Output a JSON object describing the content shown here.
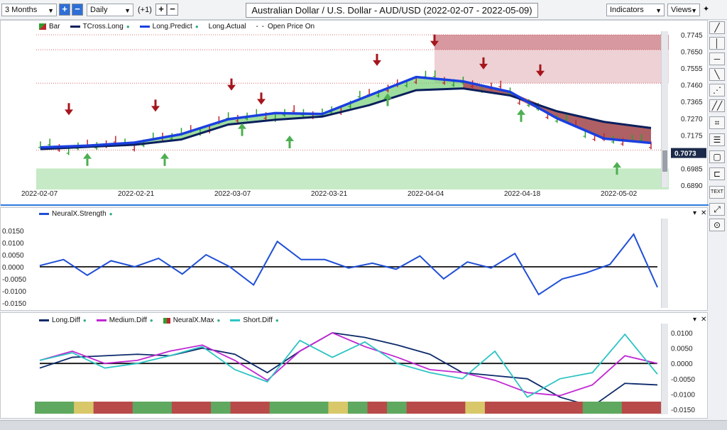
{
  "toolbar": {
    "period": "3 Months",
    "interval": "Daily",
    "offset": "(+1)",
    "indicators": "Indicators",
    "views": "Views",
    "plus": "+",
    "minus": "−",
    "pin": "✦"
  },
  "title": "Australian Dollar / U.S. Dollar - AUD/USD (2022-02-07 - 2022-05-09)",
  "main_legend": {
    "bar": "Bar",
    "tcross": "TCross.Long",
    "predict": "Long.Predict",
    "actual": "Long.Actual",
    "open_on": "Open Price On"
  },
  "price_axis": [
    "0.7745",
    "0.7650",
    "0.7555",
    "0.7460",
    "0.7365",
    "0.7270",
    "0.7175",
    "0.7080",
    "0.6985",
    "0.6890"
  ],
  "current_price": "0.7073",
  "date_axis": [
    "2022-02-07",
    "2022-02-21",
    "2022-03-07",
    "2022-03-21",
    "2022-04-04",
    "2022-04-18",
    "2022-05-02"
  ],
  "neural_legend": "NeuralX.Strength",
  "neural_axis": [
    "0.0150",
    "0.0100",
    "0.0050",
    "0.0000",
    "-0.0050",
    "-0.0100",
    "-0.0150"
  ],
  "diff_legend": {
    "long": "Long.Diff",
    "medium": "Medium.Diff",
    "max": "NeuralX.Max",
    "short": "Short.Diff"
  },
  "diff_axis": [
    "0.0100",
    "0.0050",
    "0.0000",
    "-0.0050",
    "-0.0100",
    "-0.0150"
  ],
  "right_tools": [
    "╱",
    "│",
    "─",
    "╲",
    "⋰",
    "╱╱",
    "⌗",
    "☰",
    "▢",
    "⊏",
    "TEXT",
    "⤢",
    "⊙",
    "✕"
  ],
  "panel_controls": {
    "collapse": "▾",
    "close": "✕"
  },
  "colors": {
    "up_bar": "#2e9e2e",
    "down_bar": "#c0262d",
    "tcross": "#0a1f5c",
    "predict": "#1a3fe0",
    "neural": "#1f4fd6",
    "long_diff": "#0d2a6b",
    "medium_diff": "#c026d3",
    "short_diff": "#2ec4c4",
    "up_zone": "#7ed17e",
    "down_zone": "#b04a5a"
  },
  "chart_data": [
    {
      "type": "line",
      "title": "Australian Dollar / U.S. Dollar - AUD/USD (2022-02-07 - 2022-05-09)",
      "xlabel": "",
      "ylabel": "",
      "ylim": [
        0.689,
        0.7745
      ],
      "x": [
        "2022-02-07",
        "2022-02-14",
        "2022-02-21",
        "2022-02-28",
        "2022-03-07",
        "2022-03-14",
        "2022-03-21",
        "2022-03-28",
        "2022-04-04",
        "2022-04-11",
        "2022-04-18",
        "2022-04-25",
        "2022-05-02",
        "2022-05-09"
      ],
      "series": [
        {
          "name": "TCross.Long",
          "values": [
            0.7095,
            0.7108,
            0.712,
            0.715,
            0.7235,
            0.7262,
            0.728,
            0.7345,
            0.743,
            0.744,
            0.74,
            0.731,
            0.725,
            0.7215
          ]
        },
        {
          "name": "Long.Predict",
          "values": [
            0.7105,
            0.7115,
            0.7132,
            0.718,
            0.7265,
            0.73,
            0.7295,
            0.74,
            0.7505,
            0.748,
            0.742,
            0.727,
            0.7155,
            0.713
          ]
        }
      ],
      "current_price": 0.7073
    },
    {
      "type": "line",
      "title": "",
      "ylim": [
        -0.015,
        0.015
      ],
      "series": [
        {
          "name": "NeuralX.Strength",
          "values": [
            0.0005,
            0.003,
            -0.0035,
            0.0025,
            0.0,
            0.0035,
            -0.003,
            0.005,
            0.0,
            -0.0075,
            0.0105,
            0.003,
            0.003,
            -0.0005,
            0.0015,
            -0.001,
            0.0045,
            -0.005,
            0.002,
            -0.0005,
            0.0055,
            -0.0115,
            -0.005,
            -0.0025,
            0.001,
            0.0135,
            -0.0085
          ]
        }
      ]
    },
    {
      "type": "line",
      "title": "",
      "ylim": [
        -0.015,
        0.01
      ],
      "series": [
        {
          "name": "Long.Diff",
          "values": [
            -0.0015,
            0.002,
            0.0025,
            0.003,
            0.0025,
            0.005,
            0.003,
            -0.003,
            0.004,
            0.01,
            0.0085,
            0.006,
            0.003,
            -0.003,
            -0.004,
            -0.005,
            -0.011,
            -0.014,
            -0.0065,
            -0.007
          ]
        },
        {
          "name": "Medium.Diff",
          "values": [
            0.001,
            0.004,
            0.0,
            0.001,
            0.004,
            0.006,
            0.001,
            -0.0055,
            0.004,
            0.01,
            0.0055,
            0.002,
            -0.002,
            -0.003,
            -0.0055,
            -0.0095,
            -0.0105,
            -0.007,
            0.0025,
            0.0
          ]
        },
        {
          "name": "Short.Diff",
          "values": [
            0.001,
            0.0035,
            -0.0015,
            0.0,
            0.0025,
            0.0055,
            -0.002,
            -0.006,
            0.0075,
            0.002,
            0.007,
            0.0,
            -0.003,
            -0.005,
            0.004,
            -0.011,
            -0.005,
            -0.003,
            0.0095,
            -0.0035
          ]
        }
      ],
      "neuralx_max": [
        "green",
        "green",
        "yellow",
        "red",
        "red",
        "green",
        "green",
        "red",
        "red",
        "green",
        "red",
        "red",
        "green",
        "green",
        "green",
        "yellow",
        "green",
        "red",
        "green",
        "red",
        "red",
        "red",
        "yellow",
        "red",
        "red",
        "red",
        "red",
        "red",
        "green",
        "green",
        "red",
        "red"
      ]
    }
  ]
}
